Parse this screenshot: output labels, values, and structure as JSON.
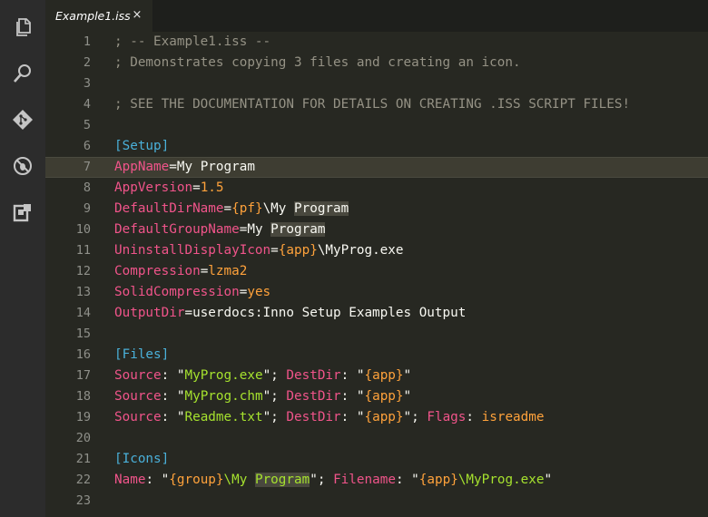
{
  "tab": {
    "title": "Example1.iss",
    "close": "×"
  },
  "activity": {
    "icons": [
      "explorer-icon",
      "search-icon",
      "git-icon",
      "debug-icon",
      "extensions-icon"
    ]
  },
  "editor": {
    "current_line": 7,
    "lines": [
      {
        "n": "1",
        "tokens": [
          {
            "t": "; -- Example1.iss --",
            "c": "comment"
          }
        ]
      },
      {
        "n": "2",
        "tokens": [
          {
            "t": "; Demonstrates copying 3 files and creating an icon.",
            "c": "comment"
          }
        ]
      },
      {
        "n": "3",
        "tokens": []
      },
      {
        "n": "4",
        "tokens": [
          {
            "t": "; SEE THE DOCUMENTATION FOR DETAILS ON CREATING .ISS SCRIPT FILES!",
            "c": "comment"
          }
        ]
      },
      {
        "n": "5",
        "tokens": []
      },
      {
        "n": "6",
        "tokens": [
          {
            "t": "[Setup]",
            "c": "section"
          }
        ]
      },
      {
        "n": "7",
        "tokens": [
          {
            "t": "AppName",
            "c": "key"
          },
          {
            "t": "=My Program",
            "c": "plain"
          }
        ]
      },
      {
        "n": "8",
        "tokens": [
          {
            "t": "AppVersion",
            "c": "key"
          },
          {
            "t": "=",
            "c": "plain"
          },
          {
            "t": "1.5",
            "c": "num"
          }
        ]
      },
      {
        "n": "9",
        "tokens": [
          {
            "t": "DefaultDirName",
            "c": "key"
          },
          {
            "t": "=",
            "c": "plain"
          },
          {
            "t": "{pf}",
            "c": "const"
          },
          {
            "t": "\\My ",
            "c": "plain"
          },
          {
            "t": "Program",
            "c": "plain",
            "hl": true
          }
        ]
      },
      {
        "n": "10",
        "tokens": [
          {
            "t": "DefaultGroupName",
            "c": "key"
          },
          {
            "t": "=My ",
            "c": "plain"
          },
          {
            "t": "Program",
            "c": "plain",
            "hl": true
          }
        ]
      },
      {
        "n": "11",
        "tokens": [
          {
            "t": "UninstallDisplayIcon",
            "c": "key"
          },
          {
            "t": "=",
            "c": "plain"
          },
          {
            "t": "{app}",
            "c": "const"
          },
          {
            "t": "\\MyProg.exe",
            "c": "plain"
          }
        ]
      },
      {
        "n": "12",
        "tokens": [
          {
            "t": "Compression",
            "c": "key"
          },
          {
            "t": "=",
            "c": "plain"
          },
          {
            "t": "lzma2",
            "c": "const"
          }
        ]
      },
      {
        "n": "13",
        "tokens": [
          {
            "t": "SolidCompression",
            "c": "key"
          },
          {
            "t": "=",
            "c": "plain"
          },
          {
            "t": "yes",
            "c": "const"
          }
        ]
      },
      {
        "n": "14",
        "tokens": [
          {
            "t": "OutputDir",
            "c": "key"
          },
          {
            "t": "=userdocs:Inno Setup Examples Output",
            "c": "plain"
          }
        ]
      },
      {
        "n": "15",
        "tokens": []
      },
      {
        "n": "16",
        "tokens": [
          {
            "t": "[Files]",
            "c": "section"
          }
        ]
      },
      {
        "n": "17",
        "tokens": [
          {
            "t": "Source",
            "c": "key"
          },
          {
            "t": ": \"",
            "c": "plain"
          },
          {
            "t": "MyProg.exe",
            "c": "str"
          },
          {
            "t": "\"; ",
            "c": "plain"
          },
          {
            "t": "DestDir",
            "c": "key"
          },
          {
            "t": ": \"",
            "c": "plain"
          },
          {
            "t": "{app}",
            "c": "const"
          },
          {
            "t": "\"",
            "c": "plain"
          }
        ]
      },
      {
        "n": "18",
        "tokens": [
          {
            "t": "Source",
            "c": "key"
          },
          {
            "t": ": \"",
            "c": "plain"
          },
          {
            "t": "MyProg.chm",
            "c": "str"
          },
          {
            "t": "\"; ",
            "c": "plain"
          },
          {
            "t": "DestDir",
            "c": "key"
          },
          {
            "t": ": \"",
            "c": "plain"
          },
          {
            "t": "{app}",
            "c": "const"
          },
          {
            "t": "\"",
            "c": "plain"
          }
        ]
      },
      {
        "n": "19",
        "tokens": [
          {
            "t": "Source",
            "c": "key"
          },
          {
            "t": ": \"",
            "c": "plain"
          },
          {
            "t": "Readme.txt",
            "c": "str"
          },
          {
            "t": "\"; ",
            "c": "plain"
          },
          {
            "t": "DestDir",
            "c": "key"
          },
          {
            "t": ": \"",
            "c": "plain"
          },
          {
            "t": "{app}",
            "c": "const"
          },
          {
            "t": "\"; ",
            "c": "plain"
          },
          {
            "t": "Flags",
            "c": "key"
          },
          {
            "t": ": ",
            "c": "plain"
          },
          {
            "t": "isreadme",
            "c": "const"
          }
        ]
      },
      {
        "n": "20",
        "tokens": []
      },
      {
        "n": "21",
        "tokens": [
          {
            "t": "[Icons]",
            "c": "section"
          }
        ]
      },
      {
        "n": "22",
        "tokens": [
          {
            "t": "Name",
            "c": "key"
          },
          {
            "t": ": \"",
            "c": "plain"
          },
          {
            "t": "{group}",
            "c": "const"
          },
          {
            "t": "\\My ",
            "c": "str"
          },
          {
            "t": "Program",
            "c": "str",
            "hl": true
          },
          {
            "t": "\"; ",
            "c": "plain"
          },
          {
            "t": "Filename",
            "c": "key"
          },
          {
            "t": ": \"",
            "c": "plain"
          },
          {
            "t": "{app}",
            "c": "const"
          },
          {
            "t": "\\MyProg.exe",
            "c": "str"
          },
          {
            "t": "\"",
            "c": "plain"
          }
        ]
      },
      {
        "n": "23",
        "tokens": []
      }
    ]
  }
}
